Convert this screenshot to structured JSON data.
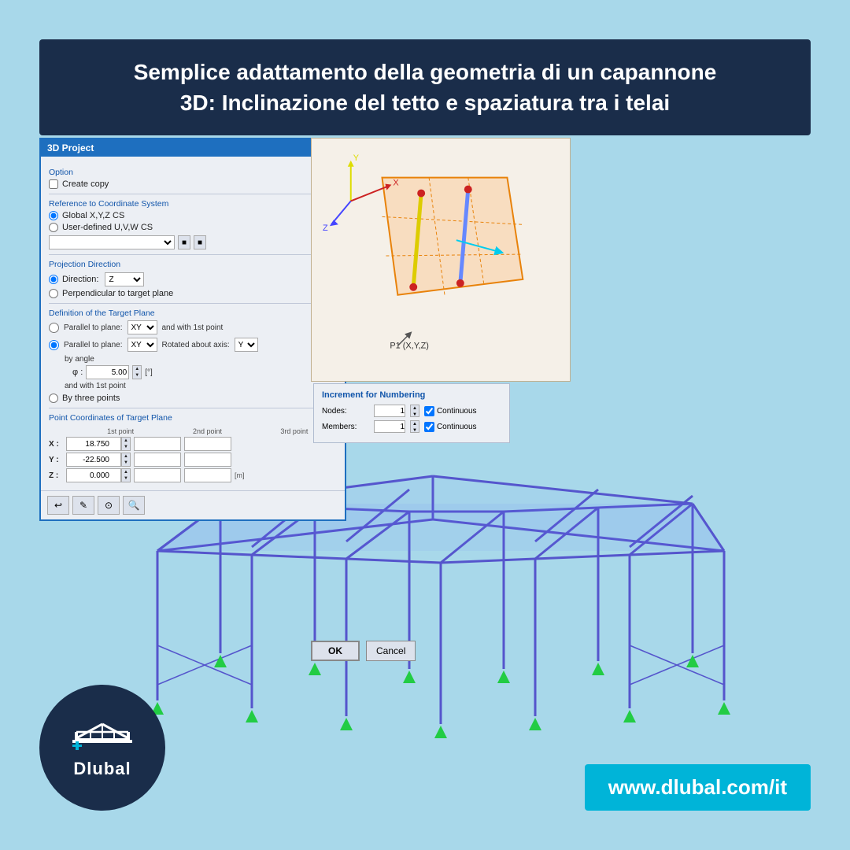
{
  "header": {
    "title_line1": "Semplice adattamento della geometria di un capannone",
    "title_line2": "3D: Inclinazione del tetto e spaziatura tra i telai"
  },
  "dialog": {
    "title": "3D Project",
    "option_label": "Option",
    "create_copy_label": "Create copy",
    "reference_label": "Reference to Coordinate System",
    "global_cs": "Global X,Y,Z CS",
    "user_defined_cs": "User-defined U,V,W CS",
    "projection_label": "Projection Direction",
    "direction_label": "Direction:",
    "direction_value": "Z",
    "perpendicular_label": "Perpendicular to target plane",
    "definition_label": "Definition of the Target Plane",
    "parallel_plane_1": "Parallel to plane:",
    "parallel_plane_2": "Parallel to plane:",
    "plane_value_1": "XY",
    "plane_value_2": "XY",
    "and_with_1st_point": "and with 1st point",
    "rotated_about_axis": "Rotated about axis:",
    "axis_value": "Y",
    "by_angle_label": "by angle",
    "phi_symbol": "φ :",
    "phi_value": "5.00",
    "phi_unit": "[°]",
    "and_with_1st_point_2": "and with 1st point",
    "by_three_points": "By three points",
    "point_coords_label": "Point Coordinates of Target Plane",
    "col_1st": "1st point",
    "col_2nd": "2nd point",
    "col_3rd": "3rd point",
    "x_label": "X :",
    "x_value": "18.750",
    "y_label": "Y :",
    "y_value": "-22.500",
    "z_label": "Z :",
    "z_value": "0.000",
    "unit": "[m]"
  },
  "increment": {
    "title": "Increment for Numbering",
    "nodes_label": "Nodes:",
    "nodes_value": "1",
    "members_label": "Members:",
    "members_value": "1",
    "continuous_label": "Continuous"
  },
  "ok_button": "OK",
  "cancel_button": "Cancel",
  "logo": {
    "name": "Dlubal"
  },
  "website": {
    "url": "www.dlubal.com/it"
  },
  "viewport": {
    "axes": {
      "x": "X",
      "y": "Y",
      "z": "Z",
      "p1_label": "P1 (X,Y,Z)"
    }
  }
}
